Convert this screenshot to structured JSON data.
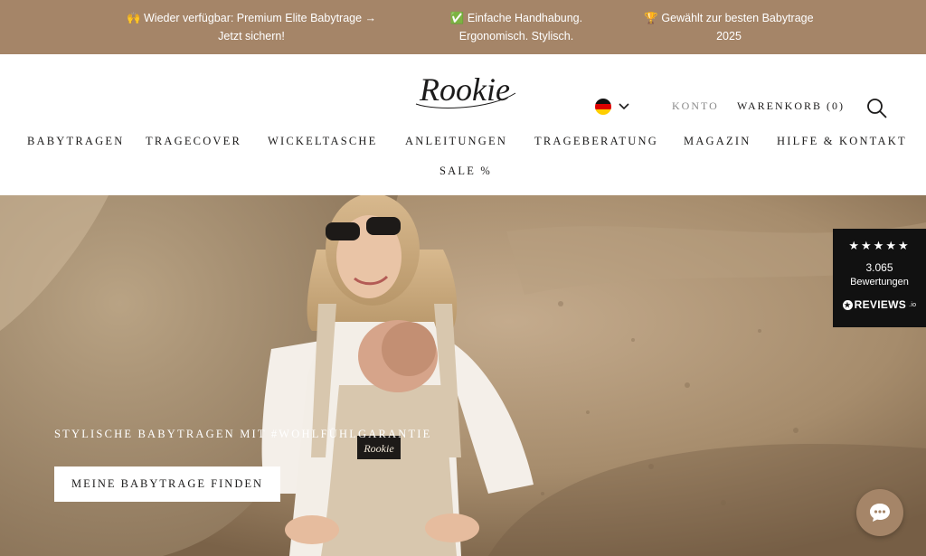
{
  "announcement": {
    "items": [
      {
        "icon": "raising-hands-icon",
        "text": "🙌 Wieder verfügbar: Premium Elite Babytrage → Jetzt sichern!"
      },
      {
        "icon": "check-mark-icon",
        "text": "✅ Einfache Handhabung. Ergonomisch. Stylisch."
      },
      {
        "icon": "trophy-icon",
        "text": "🏆 Gewählt zur besten Babytrage 2025"
      }
    ],
    "background": "#a58568"
  },
  "header": {
    "logo_text": "Rookie",
    "language": {
      "flag": "germany-flag-icon",
      "chevron": "chevron-down-icon"
    },
    "account_label": "KONTO",
    "cart_label": "WARENKORB (0)",
    "search_icon": "search-icon"
  },
  "nav": {
    "items": [
      {
        "label": "BABYTRAGEN"
      },
      {
        "label": "TRAGECOVER"
      },
      {
        "label": "WICKELTASCHE"
      },
      {
        "label": "ANLEITUNGEN"
      },
      {
        "label": "TRAGEBERATUNG"
      },
      {
        "label": "MAGAZIN"
      },
      {
        "label": "HILFE & KONTAKT"
      },
      {
        "label": "SALE %"
      }
    ]
  },
  "hero": {
    "tagline": "STYLISCHE BABYTRAGEN MIT #WOHLFÜHLGARANTIE",
    "cta_label": "MEINE BABYTRAGE FINDEN",
    "carrier_label": "Rookie"
  },
  "reviews": {
    "stars": "★★★★★",
    "rating_out_of_5": 4.5,
    "count": "3.065",
    "label": "Bewertungen",
    "brand": "REVIEWS",
    "brand_suffix": ".io"
  },
  "chat": {
    "icon": "chat-bubble-icon",
    "color": "#a58568"
  }
}
